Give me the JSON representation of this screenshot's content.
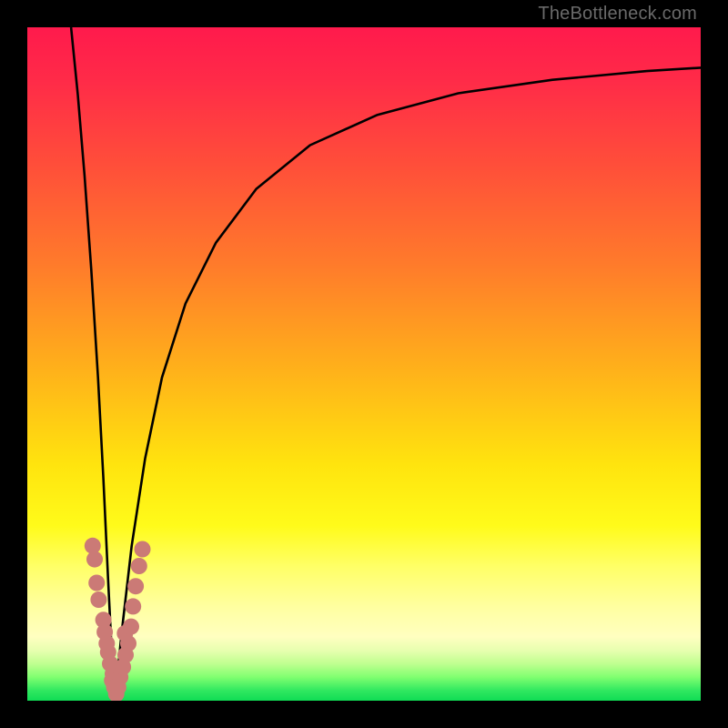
{
  "watermark": "TheBottleneck.com",
  "chart_data": {
    "type": "line",
    "title": "",
    "xlabel": "",
    "ylabel": "",
    "xlim": [
      0,
      1
    ],
    "ylim": [
      0,
      1
    ],
    "background_gradient_stops": [
      {
        "offset": 0.0,
        "color": "#ff1a4c"
      },
      {
        "offset": 0.08,
        "color": "#ff2b48"
      },
      {
        "offset": 0.2,
        "color": "#ff4d3a"
      },
      {
        "offset": 0.35,
        "color": "#ff7a2b"
      },
      {
        "offset": 0.5,
        "color": "#ffae1b"
      },
      {
        "offset": 0.65,
        "color": "#ffe40e"
      },
      {
        "offset": 0.74,
        "color": "#fffb1a"
      },
      {
        "offset": 0.8,
        "color": "#ffff66"
      },
      {
        "offset": 0.86,
        "color": "#ffffa0"
      },
      {
        "offset": 0.905,
        "color": "#ffffc0"
      },
      {
        "offset": 0.925,
        "color": "#e8ffb0"
      },
      {
        "offset": 0.945,
        "color": "#c0ff90"
      },
      {
        "offset": 0.965,
        "color": "#80ff70"
      },
      {
        "offset": 0.985,
        "color": "#30e860"
      },
      {
        "offset": 1.0,
        "color": "#10dd55"
      }
    ],
    "curve": {
      "description": "V-shaped black curve, left branch near-vertical descending, right branch rising asymptotically toward top-right",
      "left_branch": [
        {
          "x": 0.065,
          "y": 1.0
        },
        {
          "x": 0.075,
          "y": 0.9
        },
        {
          "x": 0.085,
          "y": 0.78
        },
        {
          "x": 0.095,
          "y": 0.64
        },
        {
          "x": 0.105,
          "y": 0.48
        },
        {
          "x": 0.113,
          "y": 0.33
        },
        {
          "x": 0.12,
          "y": 0.18
        },
        {
          "x": 0.126,
          "y": 0.06
        },
        {
          "x": 0.13,
          "y": 0.0
        }
      ],
      "right_branch": [
        {
          "x": 0.13,
          "y": 0.0
        },
        {
          "x": 0.14,
          "y": 0.1
        },
        {
          "x": 0.155,
          "y": 0.23
        },
        {
          "x": 0.175,
          "y": 0.36
        },
        {
          "x": 0.2,
          "y": 0.48
        },
        {
          "x": 0.235,
          "y": 0.59
        },
        {
          "x": 0.28,
          "y": 0.68
        },
        {
          "x": 0.34,
          "y": 0.76
        },
        {
          "x": 0.42,
          "y": 0.825
        },
        {
          "x": 0.52,
          "y": 0.87
        },
        {
          "x": 0.64,
          "y": 0.902
        },
        {
          "x": 0.78,
          "y": 0.922
        },
        {
          "x": 0.92,
          "y": 0.935
        },
        {
          "x": 1.0,
          "y": 0.94
        }
      ]
    },
    "scatter_points": [
      {
        "x": 0.097,
        "y": 0.23
      },
      {
        "x": 0.1,
        "y": 0.21
      },
      {
        "x": 0.103,
        "y": 0.175
      },
      {
        "x": 0.106,
        "y": 0.15
      },
      {
        "x": 0.113,
        "y": 0.12
      },
      {
        "x": 0.115,
        "y": 0.102
      },
      {
        "x": 0.118,
        "y": 0.085
      },
      {
        "x": 0.12,
        "y": 0.072
      },
      {
        "x": 0.123,
        "y": 0.055
      },
      {
        "x": 0.127,
        "y": 0.04
      },
      {
        "x": 0.126,
        "y": 0.03
      },
      {
        "x": 0.129,
        "y": 0.02
      },
      {
        "x": 0.132,
        "y": 0.01
      },
      {
        "x": 0.135,
        "y": 0.02
      },
      {
        "x": 0.138,
        "y": 0.035
      },
      {
        "x": 0.142,
        "y": 0.05
      },
      {
        "x": 0.146,
        "y": 0.068
      },
      {
        "x": 0.15,
        "y": 0.085
      },
      {
        "x": 0.145,
        "y": 0.1
      },
      {
        "x": 0.154,
        "y": 0.11
      },
      {
        "x": 0.157,
        "y": 0.14
      },
      {
        "x": 0.161,
        "y": 0.17
      },
      {
        "x": 0.166,
        "y": 0.2
      },
      {
        "x": 0.171,
        "y": 0.225
      }
    ],
    "scatter_radius_px": 9
  }
}
